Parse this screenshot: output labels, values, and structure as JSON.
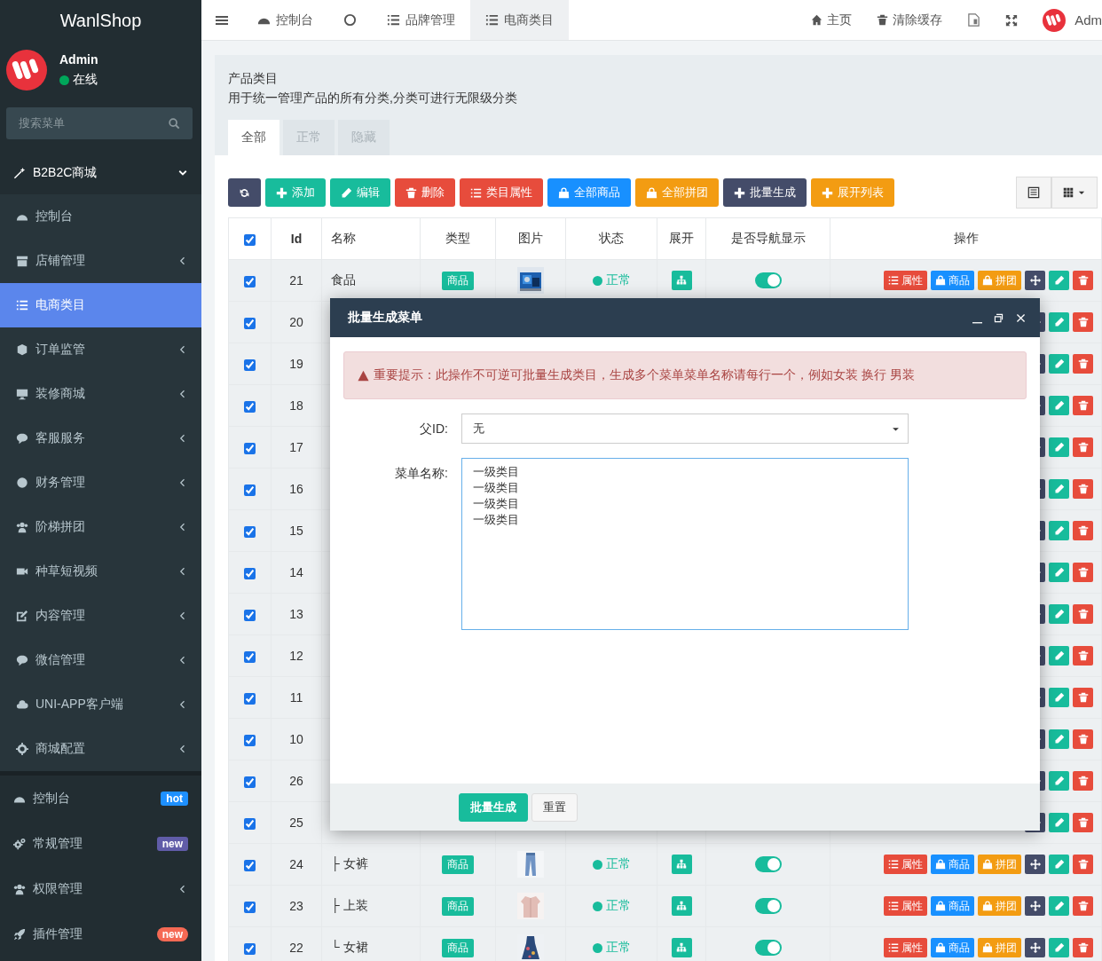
{
  "sidebar": {
    "logo": "WanlShop",
    "user": {
      "name": "Admin",
      "status": "在线",
      "online": true
    },
    "search": {
      "placeholder": "搜索菜单"
    },
    "menu": [
      {
        "label": "B2B2C商城",
        "expanded": true,
        "children": [
          {
            "label": "控制台",
            "selected": false,
            "has_submenu": false
          },
          {
            "label": "店铺管理",
            "selected": false,
            "has_submenu": true
          },
          {
            "label": "电商类目",
            "selected": true,
            "has_submenu": false
          },
          {
            "label": "订单监管",
            "selected": false,
            "has_submenu": true
          },
          {
            "label": "装修商城",
            "selected": false,
            "has_submenu": true
          },
          {
            "label": "客服服务",
            "selected": false,
            "has_submenu": true
          },
          {
            "label": "财务管理",
            "selected": false,
            "has_submenu": true
          },
          {
            "label": "阶梯拼团",
            "selected": false,
            "has_submenu": true
          },
          {
            "label": "种草短视频",
            "selected": false,
            "has_submenu": true
          },
          {
            "label": "内容管理",
            "selected": false,
            "has_submenu": true
          },
          {
            "label": "微信管理",
            "selected": false,
            "has_submenu": true
          },
          {
            "label": "UNI-APP客户端",
            "selected": false,
            "has_submenu": true
          },
          {
            "label": "商城配置",
            "selected": false,
            "has_submenu": true
          }
        ]
      }
    ],
    "menu2": [
      {
        "label": "控制台",
        "selected": false,
        "has_submenu": false,
        "badge": {
          "text": "hot",
          "color": "#1e90ff",
          "kind": "label"
        }
      },
      {
        "label": "常规管理",
        "selected": false,
        "has_submenu": false,
        "badge": {
          "text": "new",
          "color": "#605ca8",
          "kind": "label"
        }
      },
      {
        "label": "权限管理",
        "selected": false,
        "has_submenu": true
      },
      {
        "label": "插件管理",
        "selected": false,
        "has_submenu": false,
        "badge": {
          "text": "new",
          "color": "#f56954",
          "kind": "pill"
        }
      }
    ]
  },
  "topbar": {
    "tabs": [
      {
        "label": "控制台",
        "selected": false
      },
      {
        "selected": false
      },
      {
        "label": "品牌管理",
        "selected": false
      },
      {
        "label": "电商类目",
        "selected": true
      }
    ],
    "links": [
      {
        "label": "主页"
      },
      {
        "label": "清除缓存"
      }
    ],
    "user": {
      "name": "Adm"
    }
  },
  "panel": {
    "title": "产品类目",
    "description": "用于统一管理产品的所有分类,分类可进行无限级分类",
    "tabs": [
      {
        "label": "全部",
        "selected": true
      },
      {
        "label": "正常",
        "selected": false
      },
      {
        "label": "隐藏",
        "selected": false
      }
    ]
  },
  "toolbar": {
    "buttons": [
      {
        "kind": "refresh"
      },
      {
        "kind": "add",
        "label": "添加"
      },
      {
        "kind": "edit",
        "label": "编辑"
      },
      {
        "kind": "delete",
        "label": "删除"
      },
      {
        "kind": "attributes",
        "label": "类目属性"
      },
      {
        "kind": "goods",
        "label": "全部商品"
      },
      {
        "kind": "group",
        "label": "全部拼团"
      },
      {
        "kind": "batch",
        "label": "批量生成"
      },
      {
        "kind": "expand",
        "label": "展开列表"
      }
    ]
  },
  "table": {
    "header_checked": true,
    "columns": [
      "Id",
      "名称",
      "类型",
      "图片",
      "状态",
      "展开",
      "是否导航显示",
      "操作"
    ],
    "rows": [
      {
        "checked": true,
        "id": "21",
        "name": "食品",
        "type": "商品",
        "status": "正常",
        "nav_shown": true,
        "actions": [
          {
            "kind": "attributes",
            "label": "属性"
          },
          {
            "kind": "goods",
            "label": "商品"
          },
          {
            "kind": "group",
            "label": "拼团"
          },
          {
            "kind": "move"
          },
          {
            "kind": "edit"
          },
          {
            "kind": "delete"
          }
        ]
      },
      {
        "checked": true,
        "id": "20",
        "actions": [
          {
            "kind": "move"
          },
          {
            "kind": "edit"
          },
          {
            "kind": "delete"
          }
        ]
      },
      {
        "checked": true,
        "id": "19",
        "actions": [
          {
            "kind": "move"
          },
          {
            "kind": "edit"
          },
          {
            "kind": "delete"
          }
        ]
      },
      {
        "checked": true,
        "id": "18",
        "actions": [
          {
            "kind": "move"
          },
          {
            "kind": "edit"
          },
          {
            "kind": "delete"
          }
        ]
      },
      {
        "checked": true,
        "id": "17",
        "actions": [
          {
            "kind": "move"
          },
          {
            "kind": "edit"
          },
          {
            "kind": "delete"
          }
        ]
      },
      {
        "checked": true,
        "id": "16",
        "actions": [
          {
            "kind": "move"
          },
          {
            "kind": "edit"
          },
          {
            "kind": "delete"
          }
        ]
      },
      {
        "checked": true,
        "id": "15",
        "actions": [
          {
            "kind": "move"
          },
          {
            "kind": "edit"
          },
          {
            "kind": "delete"
          }
        ]
      },
      {
        "checked": true,
        "id": "14",
        "actions": [
          {
            "kind": "move"
          },
          {
            "kind": "edit"
          },
          {
            "kind": "delete"
          }
        ]
      },
      {
        "checked": true,
        "id": "13",
        "actions": [
          {
            "kind": "move"
          },
          {
            "kind": "edit"
          },
          {
            "kind": "delete"
          }
        ]
      },
      {
        "checked": true,
        "id": "12",
        "actions": [
          {
            "kind": "move"
          },
          {
            "kind": "edit"
          },
          {
            "kind": "delete"
          }
        ]
      },
      {
        "checked": true,
        "id": "11",
        "actions": [
          {
            "kind": "move"
          },
          {
            "kind": "edit"
          },
          {
            "kind": "delete"
          }
        ]
      },
      {
        "checked": true,
        "id": "10",
        "actions": [
          {
            "kind": "move"
          },
          {
            "kind": "edit"
          },
          {
            "kind": "delete"
          }
        ]
      },
      {
        "checked": true,
        "id": "26",
        "actions": [
          {
            "kind": "move"
          },
          {
            "kind": "edit"
          },
          {
            "kind": "delete"
          }
        ]
      },
      {
        "checked": true,
        "id": "25",
        "actions": [
          {
            "kind": "move"
          },
          {
            "kind": "edit"
          },
          {
            "kind": "delete"
          }
        ]
      },
      {
        "checked": true,
        "id": "24",
        "name": "├ 女裤",
        "type": "商品",
        "status": "正常",
        "nav_shown": true,
        "actions": [
          {
            "kind": "attributes",
            "label": "属性"
          },
          {
            "kind": "goods",
            "label": "商品"
          },
          {
            "kind": "group",
            "label": "拼团"
          },
          {
            "kind": "move"
          },
          {
            "kind": "edit"
          },
          {
            "kind": "delete"
          }
        ]
      },
      {
        "checked": true,
        "id": "23",
        "name": "├ 上装",
        "type": "商品",
        "status": "正常",
        "nav_shown": true,
        "actions": [
          {
            "kind": "attributes",
            "label": "属性"
          },
          {
            "kind": "goods",
            "label": "商品"
          },
          {
            "kind": "group",
            "label": "拼团"
          },
          {
            "kind": "move"
          },
          {
            "kind": "edit"
          },
          {
            "kind": "delete"
          }
        ]
      },
      {
        "checked": true,
        "id": "22",
        "name": "└ 女裙",
        "type": "商品",
        "status": "正常",
        "nav_shown": true,
        "actions": [
          {
            "kind": "attributes",
            "label": "属性"
          },
          {
            "kind": "goods",
            "label": "商品"
          },
          {
            "kind": "group",
            "label": "拼团"
          },
          {
            "kind": "move"
          },
          {
            "kind": "edit"
          },
          {
            "kind": "delete"
          }
        ]
      }
    ]
  },
  "dialog": {
    "title": "批量生成菜单",
    "notice": "重要提示：此操作不可逆可批量生成类目，生成多个菜单菜单名称请每行一个，例如女装 换行 男装",
    "fields": [
      {
        "kind": "select",
        "label": "父ID:",
        "value": "无",
        "focused": false
      },
      {
        "kind": "textarea",
        "label": "菜单名称:",
        "lines": [
          "一级类目",
          "一级类目",
          "一级类目",
          "一级类目"
        ],
        "focused": true
      }
    ],
    "buttons": [
      {
        "kind": "primary",
        "label": "批量生成"
      },
      {
        "kind": "default",
        "label": "重置"
      }
    ]
  }
}
